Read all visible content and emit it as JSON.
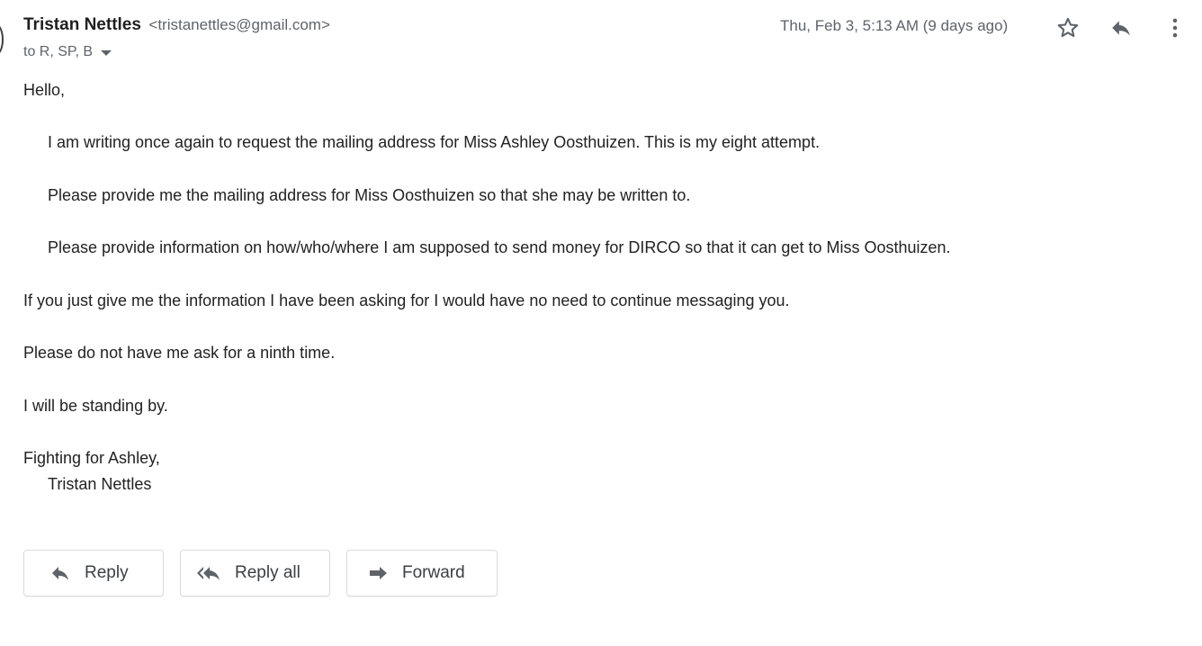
{
  "message": {
    "sender_name": "Tristan Nettles",
    "sender_email": "<tristanettles@gmail.com>",
    "recipients": "to R, SP, B",
    "timestamp": "Thu, Feb 3, 5:13 AM (9 days ago)"
  },
  "header_icons": [
    "star-icon",
    "reply-icon",
    "more-vert-icon"
  ],
  "body": {
    "greeting": "Hello,",
    "para1": "I am writing once again to request the mailing address for Miss Ashley Oosthuizen. This is my eight attempt.",
    "para2": "Please provide me the mailing address for Miss Oosthuizen so that she may be written to.",
    "para3": "Please provide information on how/who/where I am supposed to send money for DIRCO so that it can get to Miss Oosthuizen.",
    "para4": "If you just give me the information I have been asking for I would have no need to continue messaging you.",
    "para5": "Please do not have me ask for a ninth time.",
    "para6": "I will be standing by.",
    "signoff": "Fighting for Ashley,",
    "signature": "Tristan Nettles"
  },
  "actions": {
    "reply_label": "Reply",
    "reply_all_label": "Reply all",
    "forward_label": "Forward"
  },
  "colors": {
    "text": "#222222",
    "muted": "#5f6368",
    "icon": "#5f6368",
    "border": "#dadce0"
  }
}
